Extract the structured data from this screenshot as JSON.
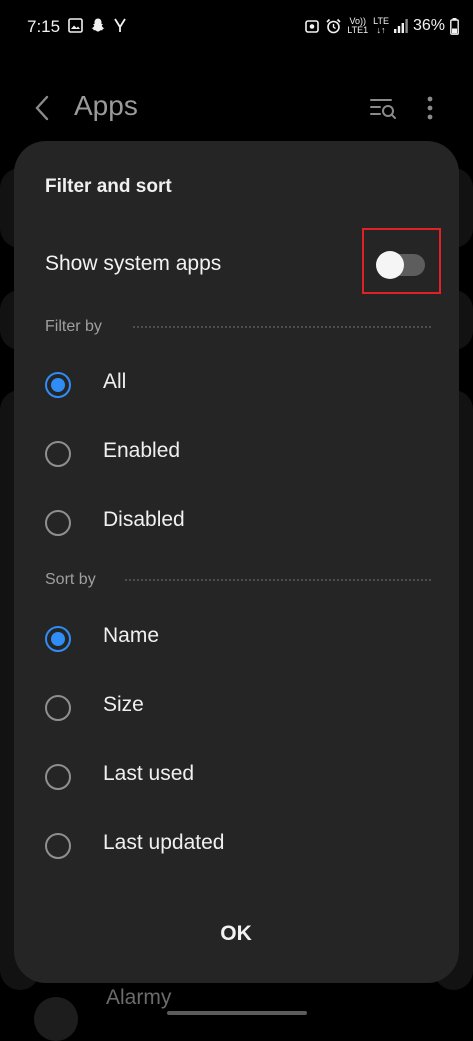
{
  "status_bar": {
    "time": "7:15",
    "volte": "Vo))",
    "lte1": "LTE1",
    "lte": "LTE",
    "battery": "36%"
  },
  "app_bar": {
    "title": "Apps"
  },
  "background": {
    "peek_item": "Alarmy"
  },
  "dialog": {
    "title": "Filter and sort",
    "show_system_apps": {
      "label": "Show system apps",
      "enabled": false
    },
    "filter_by": {
      "header": "Filter by",
      "options": [
        {
          "label": "All",
          "selected": true
        },
        {
          "label": "Enabled",
          "selected": false
        },
        {
          "label": "Disabled",
          "selected": false
        }
      ]
    },
    "sort_by": {
      "header": "Sort by",
      "options": [
        {
          "label": "Name",
          "selected": true
        },
        {
          "label": "Size",
          "selected": false
        },
        {
          "label": "Last used",
          "selected": false
        },
        {
          "label": "Last updated",
          "selected": false
        }
      ]
    },
    "ok_label": "OK"
  },
  "colors": {
    "accent": "#2f8df5",
    "highlight_box": "#e12127",
    "dialog_bg": "#252525"
  }
}
